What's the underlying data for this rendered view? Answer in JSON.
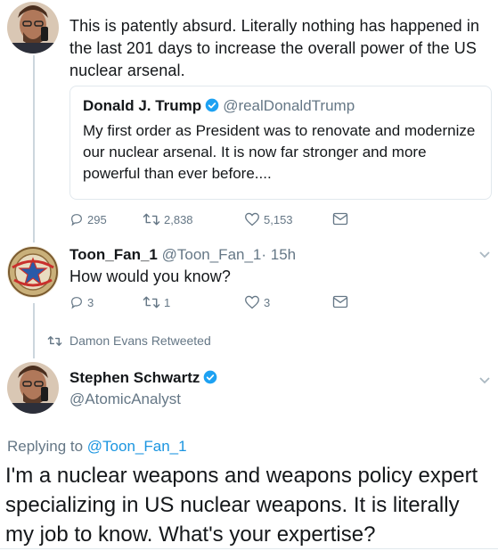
{
  "tweet_top": {
    "text": "This is patently absurd. Literally nothing has happened in the last 201 days to increase the overall power of the US nuclear arsenal."
  },
  "quoted_tweet": {
    "name": "Donald J. Trump",
    "handle": "@realDonaldTrump",
    "text": "My first order as President was to renovate and modernize our nuclear arsenal. It is now far stronger and more powerful than ever before...."
  },
  "tweet_top_actions": {
    "replies": "295",
    "retweets": "2,838",
    "likes": "5,153"
  },
  "reply_tweet": {
    "name": "Toon_Fan_1",
    "handle": "@Toon_Fan_1",
    "time": "· 15h",
    "text": "How would you know?",
    "replies": "3",
    "retweets": "1",
    "likes": "3"
  },
  "retweet_notice": "Damon Evans Retweeted",
  "main_tweet": {
    "name": "Stephen Schwartz",
    "handle": "@AtomicAnalyst",
    "replying_prefix": "Replying to",
    "replying_to": "@Toon_Fan_1",
    "text": "I'm a nuclear weapons and weapons policy expert specializing in US nuclear weapons. It is literally my job to know. What's your expertise?"
  },
  "colors": {
    "accent": "#1da1f2",
    "muted": "#657786",
    "border": "#e1e8ed"
  },
  "icons": [
    "reply-icon",
    "retweet-icon",
    "like-icon",
    "message-icon",
    "verified-icon",
    "chevron-down-icon"
  ]
}
